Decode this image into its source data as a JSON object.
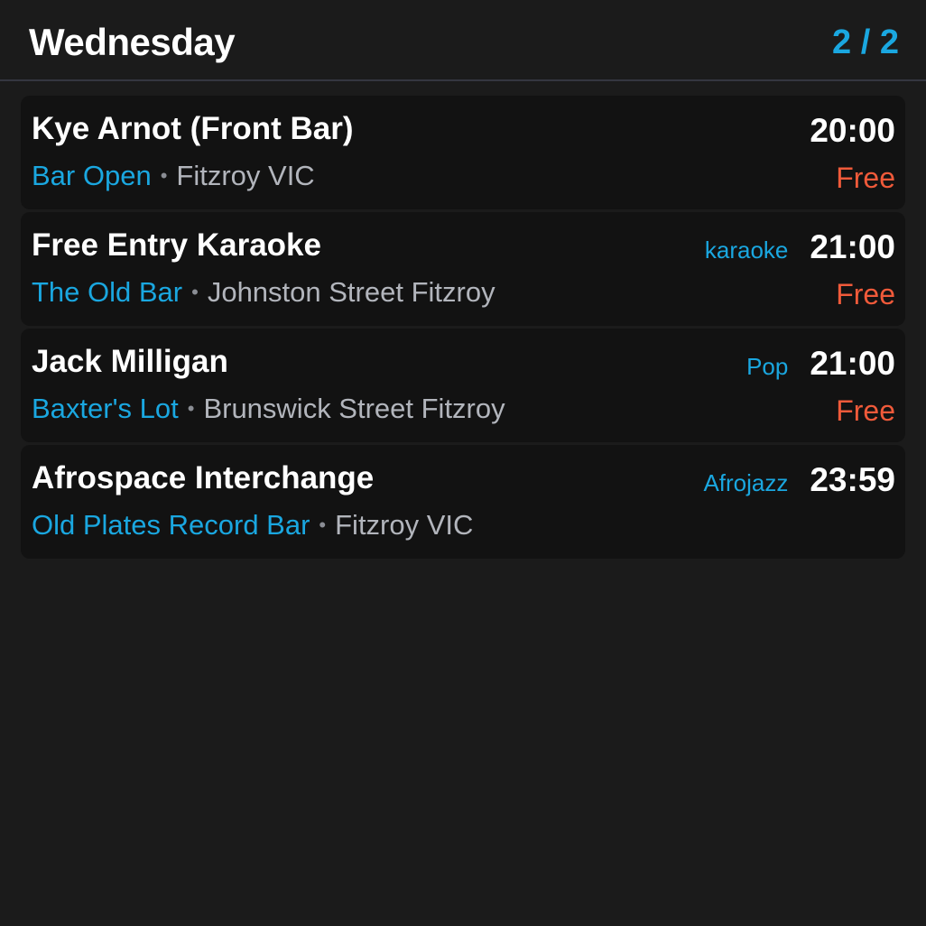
{
  "header": {
    "day": "Wednesday",
    "page_indicator": "2 / 2"
  },
  "colors": {
    "background": "#1b1b1b",
    "card": "#121212",
    "accent": "#1aa7e0",
    "price": "#f05a3a",
    "muted": "#b2b5bc"
  },
  "events": [
    {
      "title": "Kye Arnot (Front Bar)",
      "venue": "Bar Open",
      "location": "Fitzroy VIC",
      "genre": "",
      "time": "20:00",
      "price": "Free"
    },
    {
      "title": "Free Entry Karaoke",
      "venue": "The Old Bar",
      "location": "Johnston Street Fitzroy",
      "genre": "karaoke",
      "time": "21:00",
      "price": "Free"
    },
    {
      "title": "Jack Milligan",
      "venue": "Baxter's Lot",
      "location": "Brunswick Street Fitzroy",
      "genre": "Pop",
      "time": "21:00",
      "price": "Free"
    },
    {
      "title": "Afrospace Interchange",
      "venue": "Old Plates Record Bar",
      "location": "Fitzroy VIC",
      "genre": "Afrojazz",
      "time": "23:59",
      "price": ""
    }
  ]
}
